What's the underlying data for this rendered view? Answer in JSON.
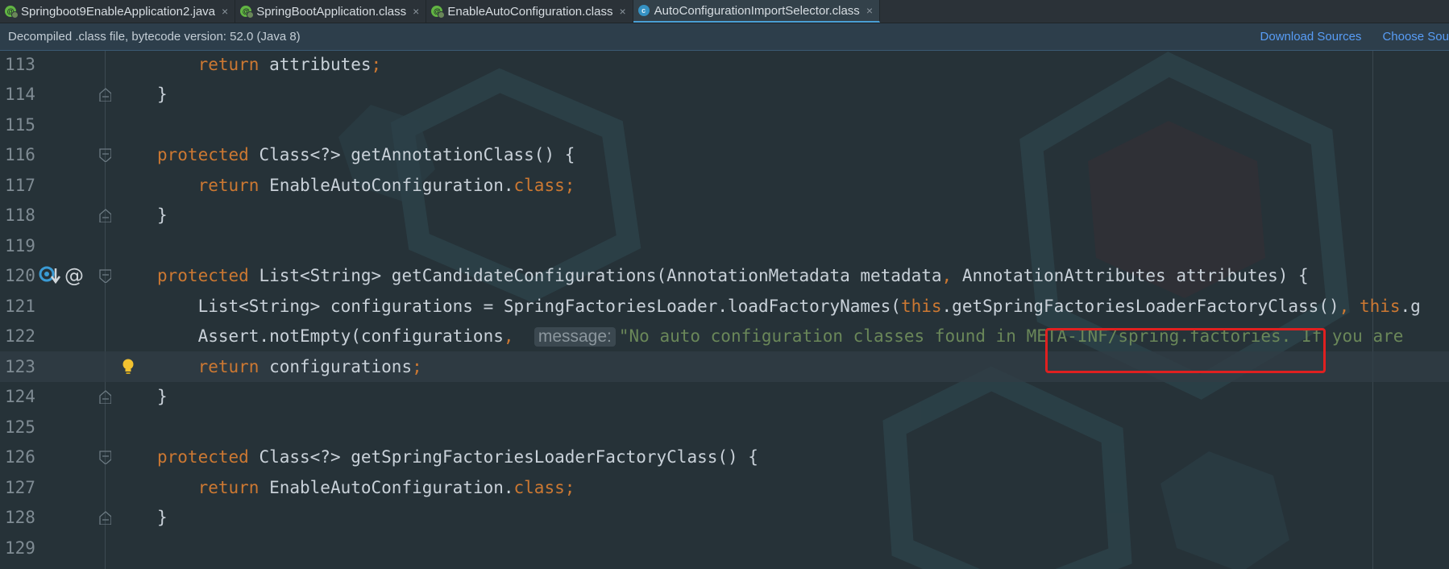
{
  "tabs": [
    {
      "label": "Springboot9EnableApplication2.java",
      "icon": "spring-java-icon",
      "active": false
    },
    {
      "label": "SpringBootApplication.class",
      "icon": "annotation-icon",
      "active": false
    },
    {
      "label": "EnableAutoConfiguration.class",
      "icon": "annotation-icon",
      "active": false
    },
    {
      "label": "AutoConfigurationImportSelector.class",
      "icon": "class-icon",
      "active": true
    }
  ],
  "tab_close_glyph": "×",
  "infobar": {
    "text": "Decompiled .class file, bytecode version: 52.0 (Java 8)",
    "download_sources": "Download Sources",
    "choose_sources": "Choose Sou"
  },
  "lines": [
    {
      "n": "113",
      "tokens": [
        {
          "t": "    "
        },
        {
          "t": "return",
          "c": "kw"
        },
        {
          "t": " attributes"
        },
        {
          "t": ";",
          "c": "kw"
        }
      ]
    },
    {
      "n": "114",
      "tokens": [
        {
          "t": "}"
        }
      ],
      "fold": "end"
    },
    {
      "n": "115",
      "tokens": []
    },
    {
      "n": "116",
      "tokens": [
        {
          "t": "protected",
          "c": "kw"
        },
        {
          "t": " Class<?> getAnnotationClass() {"
        }
      ],
      "fold": "start"
    },
    {
      "n": "117",
      "tokens": [
        {
          "t": "    "
        },
        {
          "t": "return",
          "c": "kw"
        },
        {
          "t": " EnableAutoConfiguration."
        },
        {
          "t": "class;",
          "c": "kw"
        }
      ]
    },
    {
      "n": "118",
      "tokens": [
        {
          "t": "}"
        }
      ],
      "fold": "end"
    },
    {
      "n": "119",
      "tokens": []
    },
    {
      "n": "120",
      "tokens": [
        {
          "t": "protected",
          "c": "kw"
        },
        {
          "t": " List<String> getCandidateConfigurations(AnnotationMetadata metadata"
        },
        {
          "t": ",",
          "c": "kw"
        },
        {
          "t": " AnnotationAttributes attributes) {"
        }
      ],
      "fold": "start",
      "gutter": true
    },
    {
      "n": "121",
      "tokens": [
        {
          "t": "    List<String> configurations = SpringFactoriesLoader.loadFactoryNames("
        },
        {
          "t": "this",
          "c": "kw"
        },
        {
          "t": ".getSpringFactoriesLoaderFactoryClass()"
        },
        {
          "t": ",",
          "c": "kw"
        },
        {
          "t": " "
        },
        {
          "t": "this",
          "c": "kw"
        },
        {
          "t": ".g"
        }
      ]
    },
    {
      "n": "122",
      "tokens": [
        {
          "t": "    Assert.notEmpty(configurations"
        },
        {
          "t": ",",
          "c": "kw"
        },
        {
          "t": "  "
        },
        {
          "t": "message:",
          "c": "hint"
        },
        {
          "t": "\"No auto configuration classes found in META-INF/spring.factories. If you are",
          "c": "str"
        }
      ]
    },
    {
      "n": "123",
      "tokens": [
        {
          "t": "    "
        },
        {
          "t": "return",
          "c": "kw"
        },
        {
          "t": " configurations"
        },
        {
          "t": ";",
          "c": "kw"
        }
      ],
      "current": true,
      "bulb": true
    },
    {
      "n": "124",
      "tokens": [
        {
          "t": "}"
        }
      ],
      "fold": "end"
    },
    {
      "n": "125",
      "tokens": []
    },
    {
      "n": "126",
      "tokens": [
        {
          "t": "protected",
          "c": "kw"
        },
        {
          "t": " Class<?> getSpringFactoriesLoaderFactoryClass() {"
        }
      ],
      "fold": "start"
    },
    {
      "n": "127",
      "tokens": [
        {
          "t": "    "
        },
        {
          "t": "return",
          "c": "kw"
        },
        {
          "t": " EnableAutoConfiguration."
        },
        {
          "t": "class;",
          "c": "kw"
        }
      ]
    },
    {
      "n": "128",
      "tokens": [
        {
          "t": "}"
        }
      ],
      "fold": "end"
    },
    {
      "n": "129",
      "tokens": []
    }
  ],
  "gutter_icons": [
    "implemented-method-icon",
    "annotation-at-icon"
  ],
  "gutter_at_glyph": "@",
  "colors": {
    "keyword": "#cc7832",
    "string": "#6a8759",
    "link": "#589df6",
    "highlight_box": "#e02020"
  }
}
